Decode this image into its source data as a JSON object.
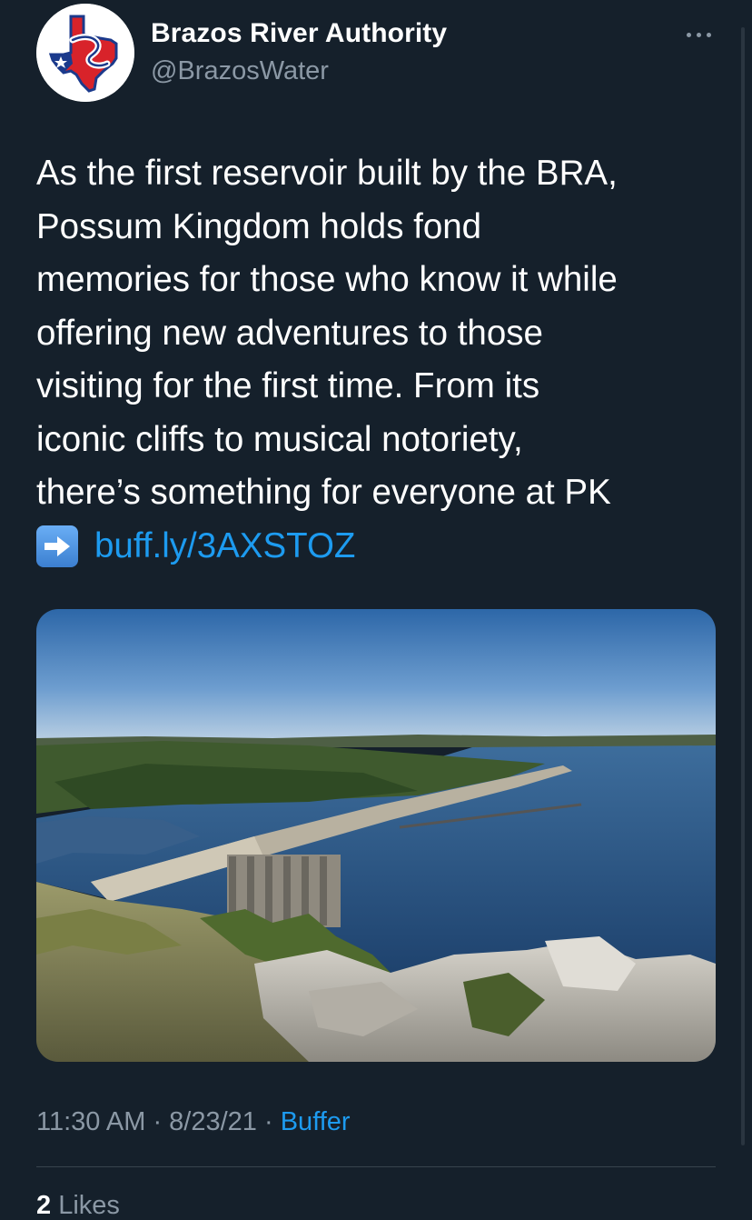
{
  "author": {
    "display_name": "Brazos River Authority",
    "handle": "@BrazosWater",
    "avatar_icon": "bra-texas-logo"
  },
  "more_icon": "more-dots-icon",
  "tweet": {
    "lines": [
      "As the first reservoir built by the BRA,",
      "Possum Kingdom holds fond",
      "memories for those who know it while",
      "offering new adventures to those",
      "visiting for the first time. From its",
      "iconic cliffs to musical notoriety,",
      "there’s something for everyone at PK"
    ],
    "link_icon": "right-arrow-emoji",
    "link_text": "buff.ly/3AXSTOZ"
  },
  "meta": {
    "time": "11:30 AM",
    "sep1": " · ",
    "date": "8/23/21",
    "sep2": " · ",
    "source": "Buffer"
  },
  "likes": {
    "count": "2",
    "label": "Likes"
  },
  "colors": {
    "background": "#15202b",
    "text": "#ffffff",
    "secondary": "#8b98a5",
    "accent": "#1d9bf0",
    "divider": "#38444d"
  }
}
